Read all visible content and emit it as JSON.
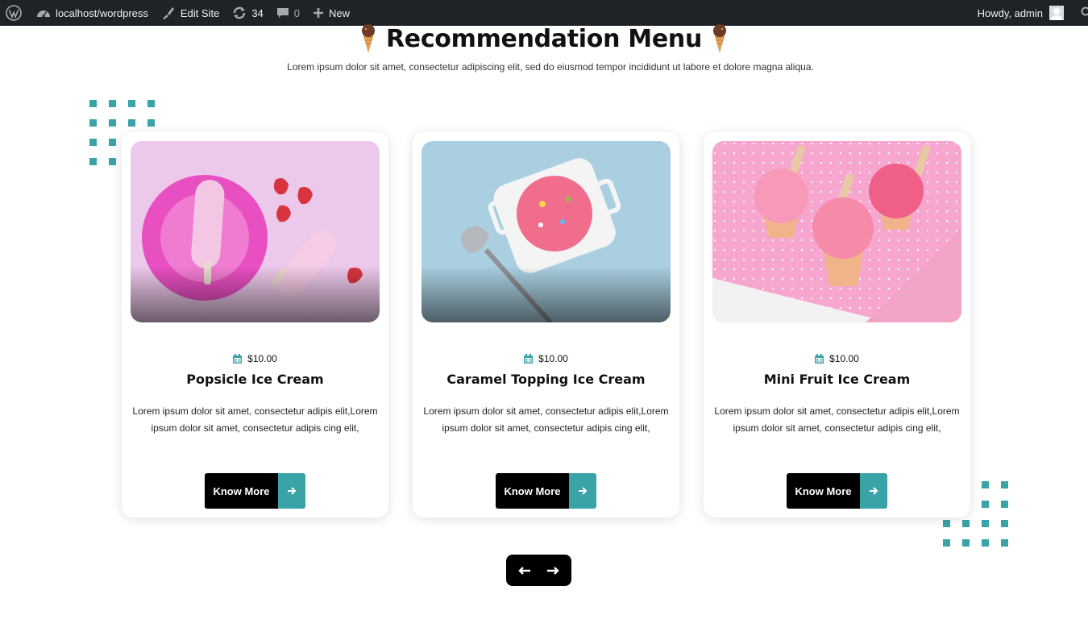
{
  "adminbar": {
    "site_name": "localhost/wordpress",
    "edit_site": "Edit Site",
    "updates_count": "34",
    "comments_count": "0",
    "new_label": "New",
    "howdy": "Howdy, admin"
  },
  "section": {
    "title": "Recommendation Menu",
    "subtitle": "Lorem ipsum dolor sit amet, consectetur adipiscing elit, sed do eiusmod tempor incididunt ut labore et dolore magna aliqua."
  },
  "cards": [
    {
      "price": "$10.00",
      "title": "Popsicle Ice Cream",
      "text": "Lorem ipsum dolor sit amet, consectetur adipis elit,Lorem ipsum dolor sit amet, consectetur adipis cing elit,",
      "button": "Know More"
    },
    {
      "price": "$10.00",
      "title": "Caramel Topping Ice Cream",
      "text": "Lorem ipsum dolor sit amet, consectetur adipis elit,Lorem ipsum dolor sit amet, consectetur adipis cing elit,",
      "button": "Know More"
    },
    {
      "price": "$10.00",
      "title": "Mini Fruit Ice Cream",
      "text": "Lorem ipsum dolor sit amet, consectetur adipis elit,Lorem ipsum dolor sit amet, consectetur adipis cing elit,",
      "button": "Know More"
    }
  ],
  "icons": {
    "wp": "wordpress-logo-icon",
    "site": "dashboard-icon",
    "edit": "brush-icon",
    "updates": "refresh-icon",
    "comments": "comment-icon",
    "new": "plus-icon",
    "price": "calendar-icon",
    "button": "arrow-right-icon",
    "prev": "arrow-left-icon",
    "next": "arrow-right-icon"
  },
  "colors": {
    "accent": "#3aa3a8",
    "adminbar": "#1d2327",
    "button": "#000000"
  }
}
